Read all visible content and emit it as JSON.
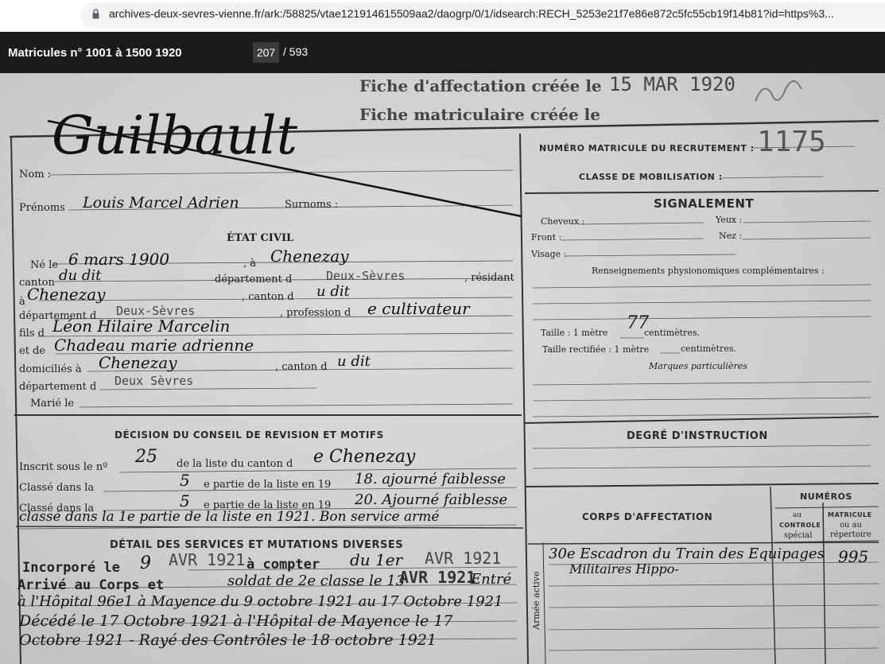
{
  "browser": {
    "url": "archives-deux-sevres-vienne.fr/ark:/58825/vtae121914615509aa2/daogrp/0/1/idsearch:RECH_5253e21f7e86e872c5fc55cb19f14b81?id=https%3..."
  },
  "viewer": {
    "title": "Matricules n° 1001 à 1500 1920",
    "page_current": "207",
    "page_total": "/ 593"
  },
  "document": {
    "header_print_1": "Fiche d'affectation créée le",
    "header_stamp_1": "15  MAR 1920",
    "header_print_2": "Fiche matriculaire créée le",
    "nom_label": "Nom :",
    "nom_value": "Guilbault",
    "prenoms_label": "Prénoms",
    "prenoms_value": "Louis Marcel Adrien",
    "surnoms_label": "Surnoms :",
    "etat_civil_title": "ÉTAT CIVIL",
    "ne_le_label": "Né le",
    "ne_le_value": "6 mars 1900",
    "a_label": ", à",
    "a_value": "Chenezay",
    "canton_label": "canton",
    "canton_value": "du dit",
    "departement_d_label": "département d",
    "departement_d_value": "Deux-Sèvres",
    "resident_label": ", résidant",
    "a2_label": "à",
    "a2_value": "Chenezay",
    "canton2_label": ", canton d",
    "canton2_value": "u dit",
    "departement2_label": "département d",
    "departement2_value": "Deux-Sèvres",
    "profession_label": ", profession d",
    "profession_value": "e cultivateur",
    "fils_label": "fils d",
    "fils_value": "Léon Hilaire Marcelin",
    "et_de_label": "et de",
    "et_de_value": "Chadeau marie adrienne",
    "domicilies_label": "domiciliés à",
    "domicilies_value": "Chenezay",
    "canton3_label": ", canton d",
    "canton3_value": "u dit",
    "departement3_label": "département d",
    "departement3_value": "Deux Sèvres",
    "marie_label": "Marié le",
    "decision_title": "DÉCISION DU CONSEIL DE REVISION ET MOTIFS",
    "inscrit_label": "Inscrit sous le nº",
    "inscrit_value": "25",
    "liste_canton_label": "de la liste du canton d",
    "liste_canton_value": "e Chenezay",
    "classe1_label": "Classé dans la",
    "classe1_value": "5",
    "partie1_label": "e partie de la liste en 19",
    "partie1_value": "18. ajourné faiblesse",
    "classe2_label": "Classé dans la",
    "classe2_value": "5",
    "partie2_label": "e partie de la liste en 19",
    "partie2_value": "20. Ajourné faiblesse",
    "classe3_value": "classé dans la 1e partie de la liste en 1921. Bon service armé",
    "detail_title": "DÉTAIL DES SERVICES ET MUTATIONS DIVERSES",
    "incorpore_label": "Incorporé le",
    "incorpore_value": "9",
    "incorpore_stamp": "AVR 1921",
    "compter_label": "à compter",
    "compter_value": "du 1er",
    "compter_stamp": "AVR 1921",
    "arrive_label": "Arrivé au Corps et",
    "arrive_value": "soldat de 2e classe le 13",
    "arrive_stamp": "AVR 1921",
    "entre_value": "Entré",
    "detail_line2": "à l'Hôpital 96e1 à Mayence du 9 octobre 1921 au 17 Octobre 1921",
    "detail_line3": "Décédé le 17 Octobre 1921 à l'Hôpital de Mayence le 17",
    "detail_line4": "Octobre 1921 - Rayé des Contrôles le 18 octobre 1921",
    "numero_matricule_label": "NUMÉRO MATRICULE DU RECRUTEMENT :",
    "numero_matricule_value": "1175",
    "classe_mobilisation_label": "CLASSE DE MOBILISATION :",
    "signalement_title": "SIGNALEMENT",
    "cheveux_label": "Cheveux :",
    "yeux_label": "Yeux :",
    "front_label": "Front :",
    "nez_label": "Nez :",
    "visage_label": "Visage :",
    "renseignements_label": "Renseignements physionomiques complémentaires :",
    "taille_label": "Taille : 1 mètre",
    "taille_value": "77",
    "centimetres_label": "centimètres.",
    "taille_rectifiee_label": "Taille rectifiée : 1 mètre",
    "centimetres2_label": "centimètres.",
    "marques_label": "Marques particulières",
    "degre_title": "DEGRÉ D'INSTRUCTION",
    "corps_title": "CORPS D'AFFECTATION",
    "numeros_title": "NUMÉROS",
    "controle_label_1": "au",
    "controle_label_2": "CONTROLE",
    "controle_label_3": "spécial",
    "repertoire_label_1": "MATRICULE",
    "repertoire_label_2": "ou au",
    "repertoire_label_3": "répertoire",
    "armee_active_label": "Armée active",
    "corps_value_1": "30e Escadron du Train des Equipages",
    "corps_value_2": "Militaires Hippo-",
    "repertoire_value": "995"
  }
}
